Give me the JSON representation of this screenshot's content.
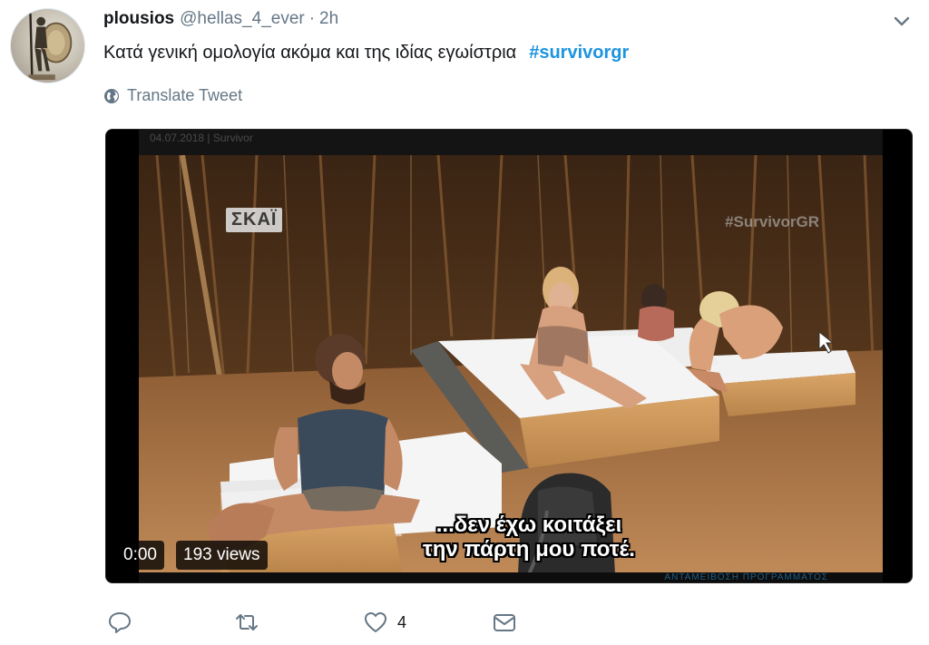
{
  "tweet": {
    "display_name": "plousios",
    "handle": "@hellas_4_ever",
    "separator": "·",
    "time": "2h",
    "text": "Κατά γενική ομολογία ακόμα και της ιδίας εγωίστρια",
    "hashtag": "#survivorgr",
    "translate_label": "Translate Tweet",
    "icons": {
      "avatar": "avatar-image",
      "caret": "chevron-down-icon",
      "translate": "globe-icon",
      "reply": "reply-icon",
      "retweet": "retweet-icon",
      "like": "heart-icon",
      "dm": "envelope-icon"
    },
    "colors": {
      "hashtag": "#1c94e0",
      "muted": "#657786",
      "text": "#14171a"
    }
  },
  "video": {
    "top_caption": "04.07.2018 | Survivor",
    "channel_logo": "ΣΚΑΪ",
    "watermark": "#SurvivorGR",
    "subtitle_line1": "...δεν έχω κοιτάξει",
    "subtitle_line2": "την πάρτη μου ποτέ.",
    "bottom_caption": "ΑΝΤΑΜΕΙΒΟΣΗ ΠΡΟΓΡΑΜΜΑΤΟΣ",
    "duration": "0:00",
    "views": "193 views"
  },
  "actions": {
    "like_count": "4"
  }
}
